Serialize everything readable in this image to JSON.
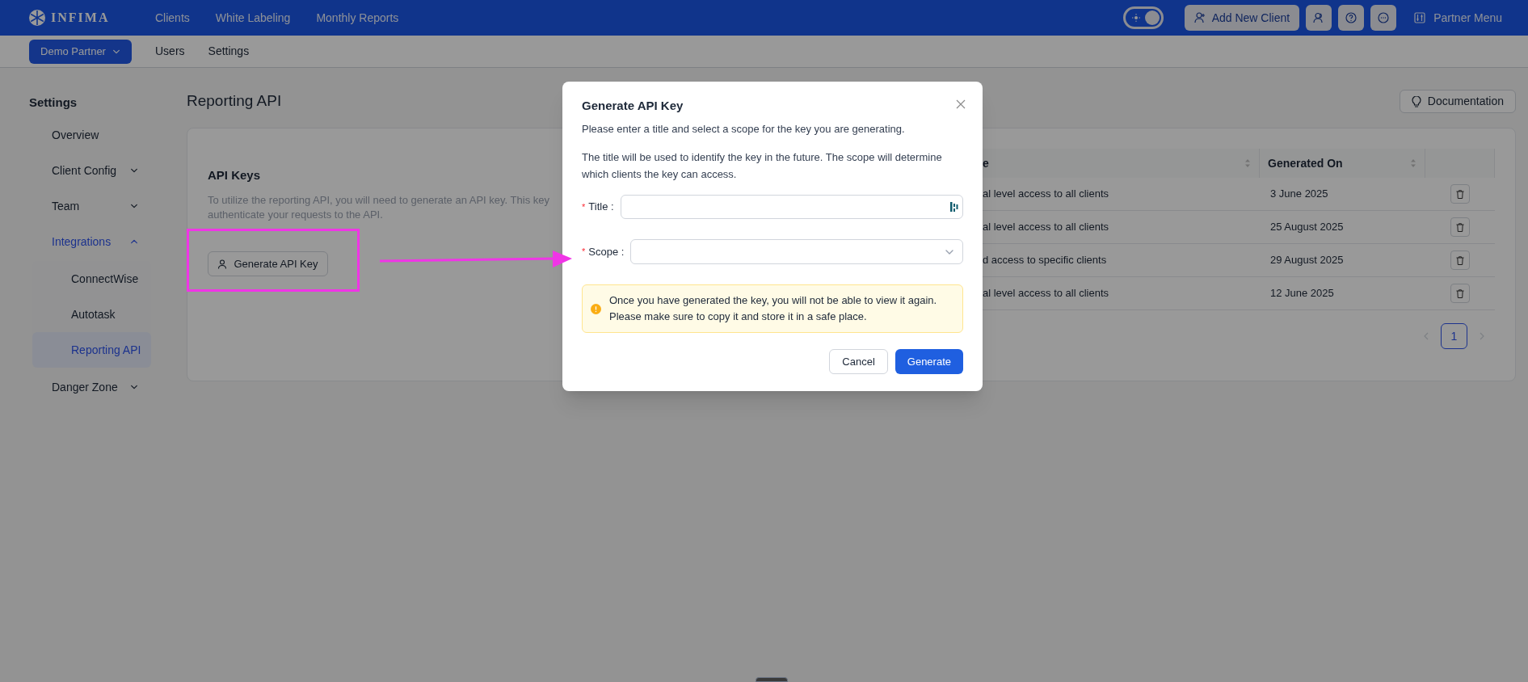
{
  "top_bar": {
    "logo": "INFIMA",
    "nav": [
      "Clients",
      "White Labeling",
      "Monthly Reports"
    ],
    "theme_toggle": {
      "on": true
    },
    "add_button": "Add New Client",
    "menu": "Partner Menu"
  },
  "sub_bar": {
    "partner": "Demo Partner",
    "links": [
      "Users",
      "Settings"
    ]
  },
  "sidebar": {
    "title": "Settings",
    "items": [
      {
        "label": "Overview",
        "kind": "link",
        "selected": false
      },
      {
        "label": "Client Config",
        "kind": "group",
        "expanded": false,
        "selected": false
      },
      {
        "label": "Team",
        "kind": "group",
        "expanded": false,
        "selected": false
      },
      {
        "label": "Integrations",
        "kind": "group",
        "expanded": true,
        "selected": false,
        "children": [
          {
            "label": "ConnectWise",
            "selected": false
          },
          {
            "label": "Autotask",
            "selected": false
          },
          {
            "label": "Reporting API",
            "selected": true
          }
        ]
      },
      {
        "label": "Danger Zone",
        "kind": "group",
        "expanded": false,
        "selected": false
      }
    ]
  },
  "page": {
    "title": "Reporting API",
    "documentation_button": "Documentation"
  },
  "api_keys": {
    "heading": "API Keys",
    "description_lines": [
      "To utilize the reporting API, you will need to generate an API key. This key",
      "authenticate your requests to the API."
    ],
    "generate_button": "Generate API Key"
  },
  "table": {
    "columns": [
      {
        "label": "e",
        "sortable": true
      },
      {
        "label": "Generated On",
        "sortable": true
      },
      {
        "sortable": false
      }
    ],
    "rows": [
      {
        "scope": "al level access to all clients",
        "generated_on": "3 June 2025"
      },
      {
        "scope": "al level access to all clients",
        "generated_on": "25 August 2025"
      },
      {
        "scope": "d access to specific clients",
        "generated_on": "29 August 2025"
      },
      {
        "scope": "al level access to all clients",
        "generated_on": "12 June 2025"
      }
    ],
    "pagination": {
      "pages": [
        {
          "label": "1",
          "selected": true
        }
      ],
      "prev_disabled": true,
      "next_disabled": true
    }
  },
  "modal": {
    "title": "Generate API Key",
    "intro": "Please enter a title and select a scope for the key you are generating.",
    "details": "The title will be used to identify the key in the future. The scope will determine which clients the key can access.",
    "fields": [
      {
        "kind": "input",
        "label": "Title :",
        "required_mark": "*"
      },
      {
        "kind": "select",
        "label": "Scope :",
        "required_mark": "*"
      }
    ],
    "warning": "Once you have generated the key, you will not be able to view it again. Please make sure to copy it and store it in a safe place.",
    "buttons": [
      {
        "label": "Cancel",
        "primary": false
      },
      {
        "label": "Generate",
        "primary": true
      }
    ]
  }
}
